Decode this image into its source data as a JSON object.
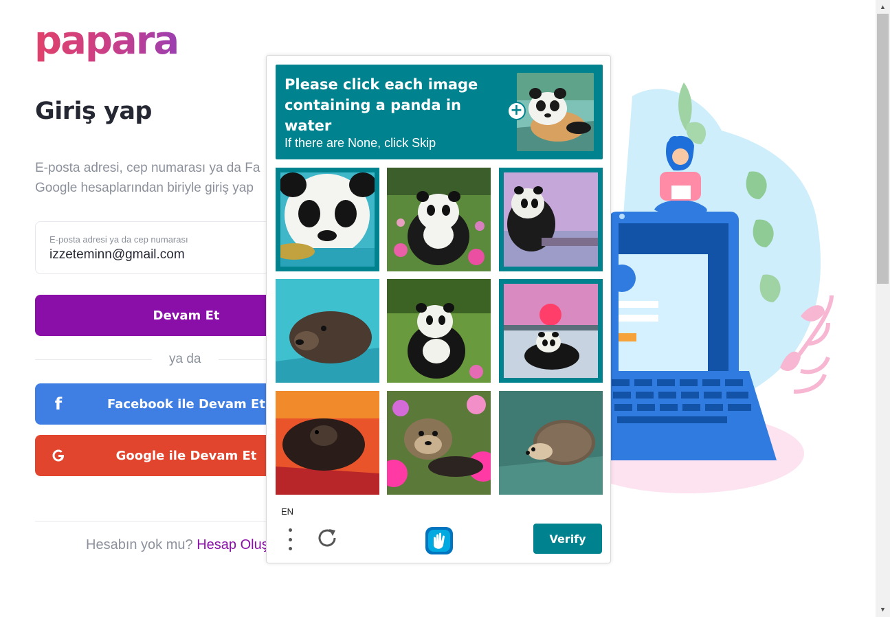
{
  "brand": {
    "logo_text": "papara"
  },
  "login": {
    "title": "Giriş yap",
    "description_line1": "E-posta adresi, cep numarası ya da Fa",
    "description_line2": "Google hesaplarından biriyle giriş yap",
    "email_label": "E-posta adresi ya da cep numarası",
    "email_value": "izzeteminn@gmail.com",
    "continue_label": "Devam Et",
    "or_text": "ya da",
    "facebook_label": "Facebook ile Devam Et",
    "google_label": "Google ile Devam Et",
    "no_account_text": "Hesabın yok mu?",
    "create_account_link": "Hesap Oluş"
  },
  "captcha": {
    "prompt": "Please click each image containing a panda in water",
    "sub_prompt": "If there are None, click Skip",
    "language": "EN",
    "verify_label": "Verify",
    "tiles": [
      {
        "subject": "panda in water",
        "selected": true
      },
      {
        "subject": "panda in flowers",
        "selected": false
      },
      {
        "subject": "panda in water",
        "selected": true
      },
      {
        "subject": "otter in water",
        "selected": false
      },
      {
        "subject": "panda on grass",
        "selected": false
      },
      {
        "subject": "panda in water at sunset",
        "selected": true
      },
      {
        "subject": "otter in sunset water",
        "selected": false
      },
      {
        "subject": "otter in flowers",
        "selected": false
      },
      {
        "subject": "hedgehog in water",
        "selected": false
      }
    ]
  },
  "colors": {
    "brand_purple": "#8a0ea8",
    "facebook_blue": "#3f7fe3",
    "google_red": "#e2452e",
    "captcha_teal": "#00838f"
  },
  "icons": {
    "facebook": "facebook-icon",
    "google": "google-icon",
    "menu": "more-vertical-icon",
    "refresh": "refresh-icon",
    "hcaptcha": "hcaptcha-logo-icon",
    "plus": "plus-icon"
  }
}
